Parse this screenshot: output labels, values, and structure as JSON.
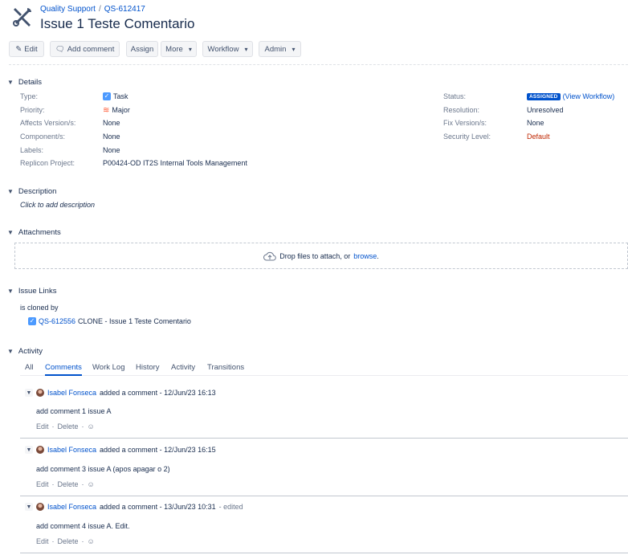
{
  "header": {
    "breadcrumb_project": "Quality Support",
    "breadcrumb_sep": "/",
    "breadcrumb_key": "QS-612417",
    "title": "Issue 1 Teste Comentario",
    "project_icon": "tools-icon"
  },
  "toolbar": {
    "edit": "Edit",
    "add_comment": "Add comment",
    "assign": "Assign",
    "more": "More",
    "workflow": "Workflow",
    "admin": "Admin"
  },
  "details": {
    "heading": "Details",
    "left": [
      {
        "label": "Type:",
        "value": "Task"
      },
      {
        "label": "Priority:",
        "value": "Major"
      },
      {
        "label": "Affects Version/s:",
        "value": "None"
      },
      {
        "label": "Component/s:",
        "value": "None"
      },
      {
        "label": "Labels:",
        "value": "None"
      },
      {
        "label": "Replicon Project:",
        "value": "P00424-OD IT2S Internal Tools Management"
      }
    ],
    "right": [
      {
        "label": "Status:",
        "value": "ASSIGNED",
        "link": "(View Workflow)"
      },
      {
        "label": "Resolution:",
        "value": "Unresolved"
      },
      {
        "label": "Fix Version/s:",
        "value": "None"
      },
      {
        "label": "Security Level:",
        "value": "Default"
      }
    ],
    "colors": {
      "status_lozenge": "#0052cc",
      "security_default": "#bf2600",
      "priority_major": "#ff5630"
    }
  },
  "description": {
    "heading": "Description",
    "placeholder": "Click to add description"
  },
  "attachments": {
    "heading": "Attachments",
    "drop_text": "Drop files to attach, or",
    "browse": "browse",
    "period": "."
  },
  "issue_links": {
    "heading": "Issue Links",
    "relation": "is cloned by",
    "key": "QS-612556",
    "summary": "CLONE - Issue 1 Teste Comentario"
  },
  "activity": {
    "heading": "Activity",
    "tabs": [
      "All",
      "Comments",
      "Work Log",
      "History",
      "Activity",
      "Transitions"
    ],
    "active_tab": "Comments",
    "comments": [
      {
        "author": "Isabel Fonseca",
        "meta": "added a comment - 12/Jun/23 16:13",
        "edited": "",
        "body": "add comment 1 issue A"
      },
      {
        "author": "Isabel Fonseca",
        "meta": "added a comment - 12/Jun/23 16:15",
        "edited": "",
        "body": "add comment 3 issue A (apos apagar o 2)"
      },
      {
        "author": "Isabel Fonseca",
        "meta": "added a comment - 13/Jun/23 10:31",
        "edited": "- edited",
        "body": "add comment 4 issue A. Edit."
      }
    ],
    "actions": {
      "edit": "Edit",
      "dot": "·",
      "delete": "Delete"
    }
  }
}
